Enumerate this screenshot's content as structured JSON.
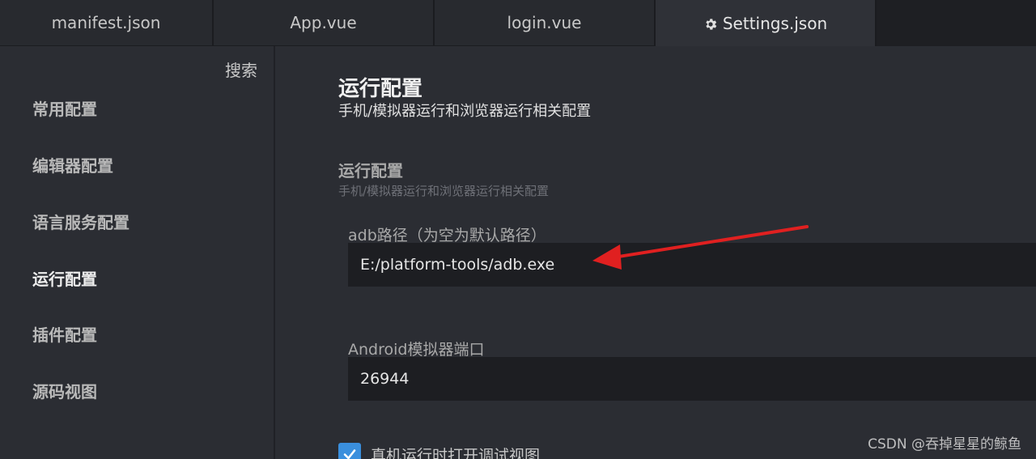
{
  "tabs": [
    {
      "label": "manifest.json"
    },
    {
      "label": "App.vue"
    },
    {
      "label": "login.vue"
    },
    {
      "label": "Settings.json",
      "icon": "gear-icon",
      "active": true
    }
  ],
  "sidebar": {
    "search_label": "搜索",
    "items": [
      {
        "label": "常用配置"
      },
      {
        "label": "编辑器配置"
      },
      {
        "label": "语言服务配置"
      },
      {
        "label": "运行配置",
        "active": true
      },
      {
        "label": "插件配置"
      },
      {
        "label": "源码视图"
      }
    ]
  },
  "main": {
    "title": "运行配置",
    "description": "手机/模拟器运行和浏览器运行相关配置",
    "section": {
      "title": "运行配置",
      "description": "手机/模拟器运行和浏览器运行相关配置"
    },
    "fields": [
      {
        "label": "adb路径（为空为默认路径）",
        "value": "E:/platform-tools/adb.exe"
      },
      {
        "label": "Android模拟器端口",
        "value": "26944"
      }
    ],
    "checkbox": {
      "label": "真机运行时打开调试视图",
      "checked": true
    }
  },
  "annotation": {
    "type": "arrow",
    "color": "#e02020",
    "points_to": "adb-path-input"
  },
  "watermark": "CSDN @吞掉星星的鲸鱼",
  "colors": {
    "accent": "#3a8fdd",
    "arrow": "#e02020"
  }
}
